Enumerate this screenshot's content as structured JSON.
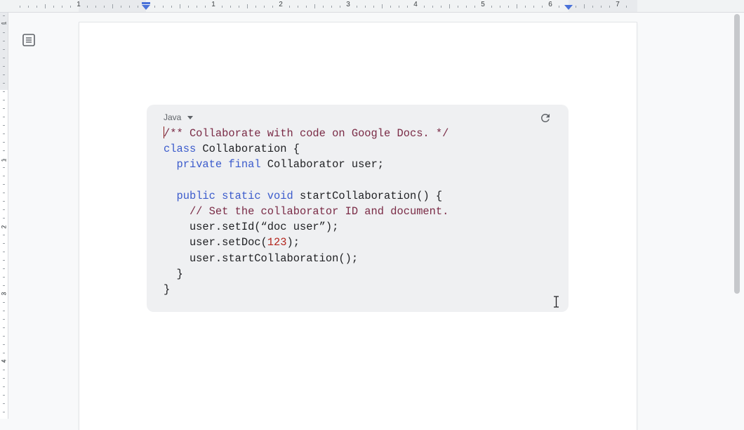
{
  "ruler": {
    "top_numbers": [
      "1",
      "1",
      "2",
      "3",
      "4",
      "5",
      "6",
      "7"
    ],
    "left_numbers": [
      "1",
      "1",
      "2",
      "3",
      "4"
    ]
  },
  "icons": {
    "outline": "document-outline-icon",
    "refresh": "refresh-icon",
    "dropdown": "caret-down-icon",
    "cursor": "i-beam-cursor-icon"
  },
  "code_block": {
    "language": "Java",
    "lines": [
      [
        {
          "t": "/** Collaborate with code on Google Docs. */",
          "c": "comment"
        }
      ],
      [
        {
          "t": "class",
          "c": "kw"
        },
        {
          "t": " Collaboration {",
          "c": ""
        }
      ],
      [
        {
          "t": "  ",
          "c": ""
        },
        {
          "t": "private final",
          "c": "kw"
        },
        {
          "t": " Collaborator user;",
          "c": ""
        }
      ],
      [],
      [
        {
          "t": "  ",
          "c": ""
        },
        {
          "t": "public static void",
          "c": "kw"
        },
        {
          "t": " startCollaboration() {",
          "c": ""
        }
      ],
      [
        {
          "t": "    // Set the collaborator ID and document.",
          "c": "comment"
        }
      ],
      [
        {
          "t": "    user.setId(“doc user”);",
          "c": ""
        }
      ],
      [
        {
          "t": "    user.setDoc(",
          "c": ""
        },
        {
          "t": "123",
          "c": "num"
        },
        {
          "t": ");",
          "c": ""
        }
      ],
      [
        {
          "t": "    user.startCollaboration();",
          "c": ""
        }
      ],
      [
        {
          "t": "  }",
          "c": ""
        }
      ],
      [
        {
          "t": "}",
          "c": ""
        }
      ]
    ]
  },
  "colors": {
    "comment": "#7a2b46",
    "keyword": "#3b5bcc",
    "number": "#b3261e",
    "code_bg": "#eff0f2",
    "indent_marker": "#4a72d9"
  }
}
